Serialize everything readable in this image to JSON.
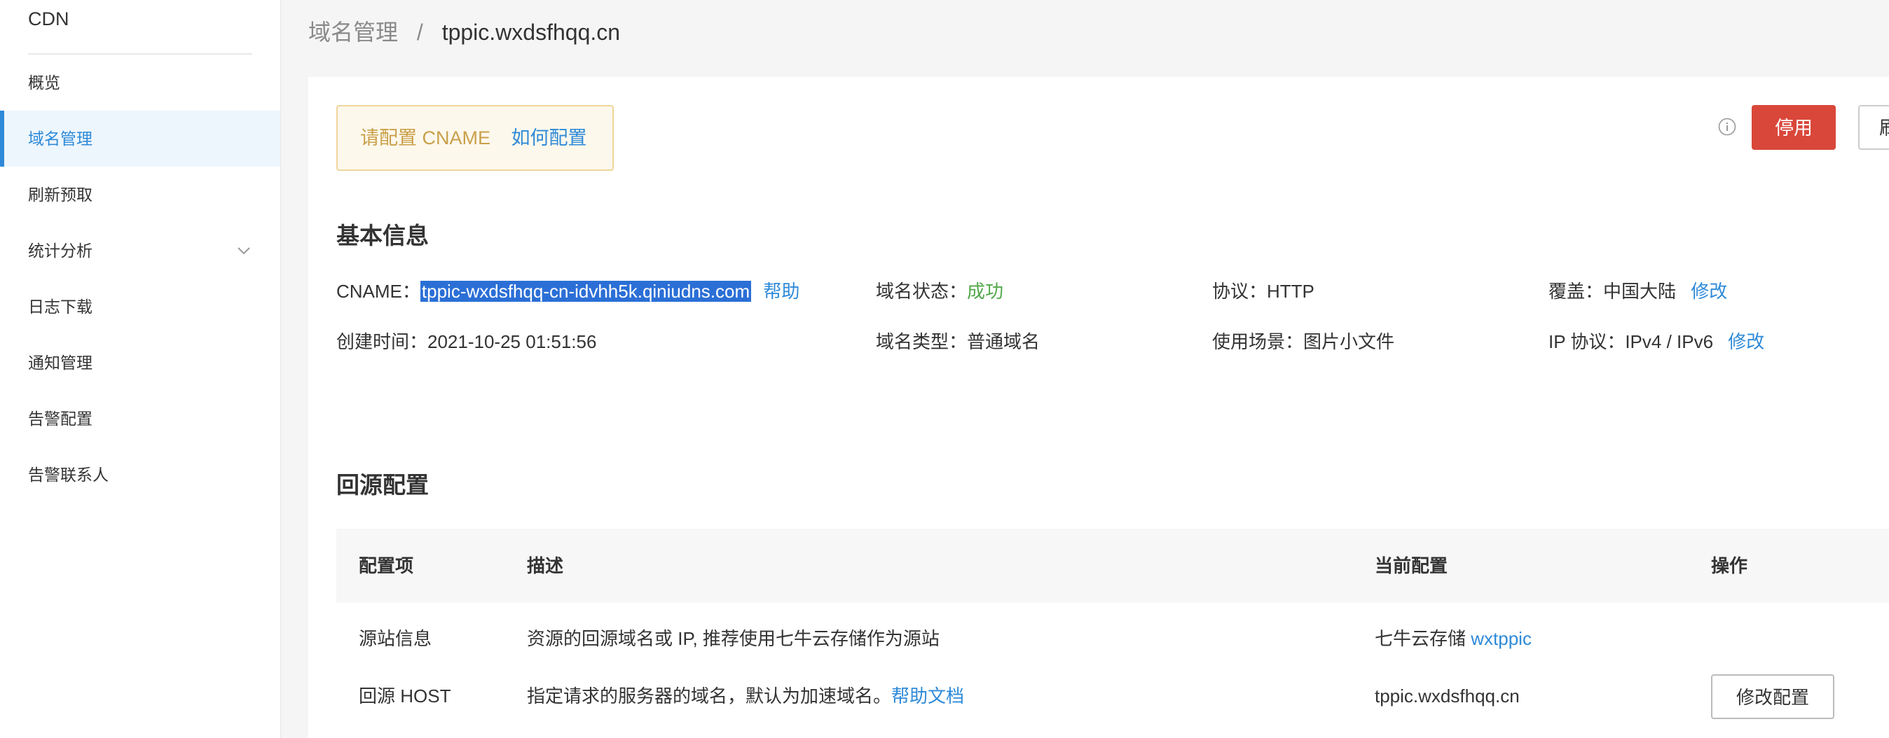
{
  "sidebar": {
    "brand": "CDN",
    "items": [
      {
        "label": "概览"
      },
      {
        "label": "域名管理"
      },
      {
        "label": "刷新预取"
      },
      {
        "label": "统计分析"
      },
      {
        "label": "日志下载"
      },
      {
        "label": "通知管理"
      },
      {
        "label": "告警配置"
      },
      {
        "label": "告警联系人"
      }
    ]
  },
  "breadcrumb": {
    "parent": "域名管理",
    "separator": "/",
    "current": "tppic.wxdsfhqq.cn"
  },
  "alert": {
    "text": "请配置 CNAME",
    "link": "如何配置"
  },
  "actions": {
    "stop_label": "停用",
    "refresh_label": "刷"
  },
  "basic_info": {
    "title": "基本信息",
    "cname_label": "CNAME：",
    "cname_value": "tppic-wxdsfhqq-cn-idvhh5k.qiniudns.com",
    "help_link": "帮助",
    "status_label": "域名状态：",
    "status_value": "成功",
    "protocol_label": "协议：",
    "protocol_value": "HTTP",
    "coverage_label": "覆盖：",
    "coverage_value": "中国大陆",
    "coverage_edit": "修改",
    "created_label": "创建时间：",
    "created_value": "2021-10-25 01:51:56",
    "type_label": "域名类型：",
    "type_value": "普通域名",
    "scene_label": "使用场景：",
    "scene_value": "图片小文件",
    "ip_label": "IP 协议：",
    "ip_value": "IPv4 / IPv6",
    "ip_edit": "修改"
  },
  "origin_config": {
    "title": "回源配置",
    "columns": [
      "配置项",
      "描述",
      "当前配置",
      "操作"
    ],
    "rows": [
      {
        "item": "源站信息",
        "desc": "资源的回源域名或 IP, 推荐使用七牛云存储作为源站",
        "current_prefix": "七牛云存储",
        "current_link": "wxtppic"
      },
      {
        "item": "回源 HOST",
        "desc": "指定请求的服务器的域名，默认为加速域名。",
        "desc_link": "帮助文档",
        "current": "tppic.wxdsfhqq.cn",
        "action": "修改配置"
      }
    ]
  },
  "colors": {
    "accent": "#2e8ad8",
    "danger": "#d9473a",
    "success": "#52a84a",
    "warning_text": "#c9a04a"
  }
}
